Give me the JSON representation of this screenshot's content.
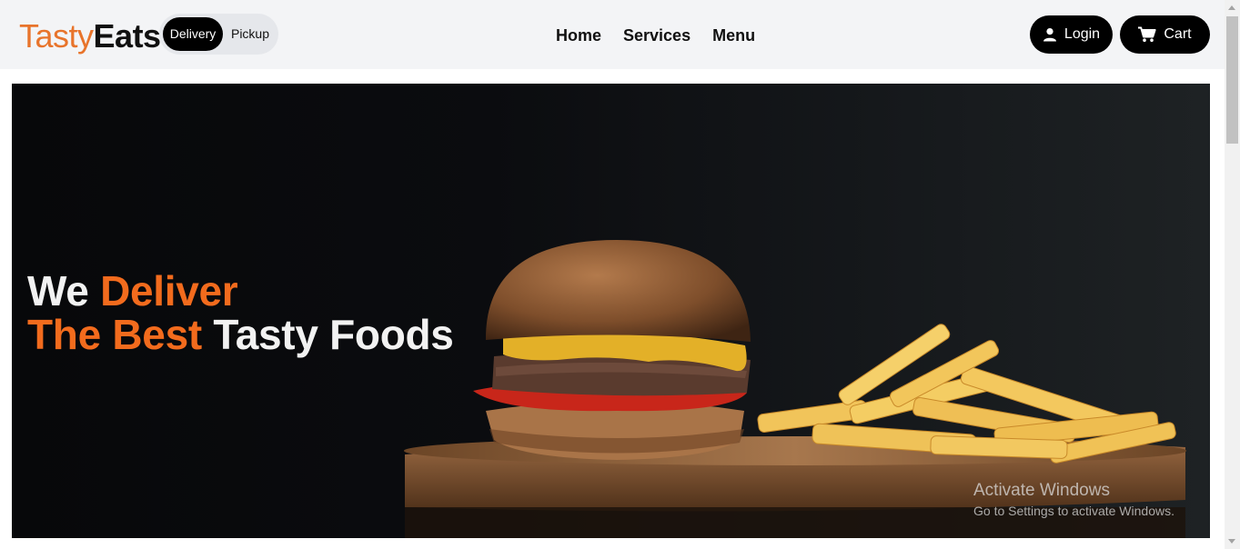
{
  "logo": {
    "part1": "Tasty",
    "part2": "Eats"
  },
  "mode_toggle": {
    "active": "Delivery",
    "inactive": "Pickup"
  },
  "nav": {
    "items": [
      "Home",
      "Services",
      "Menu"
    ]
  },
  "actions": {
    "login_label": "Login",
    "login_icon": "user-icon",
    "cart_label": "Cart",
    "cart_icon": "cart-icon"
  },
  "hero": {
    "line1_white": "We",
    "line1_orange": "Deliver",
    "line2_orange": "The Best",
    "line2_white": "Tasty Foods",
    "accent_color": "#f26b1d"
  },
  "watermark": {
    "title": "Activate Windows",
    "subtitle": "Go to Settings to activate Windows."
  }
}
